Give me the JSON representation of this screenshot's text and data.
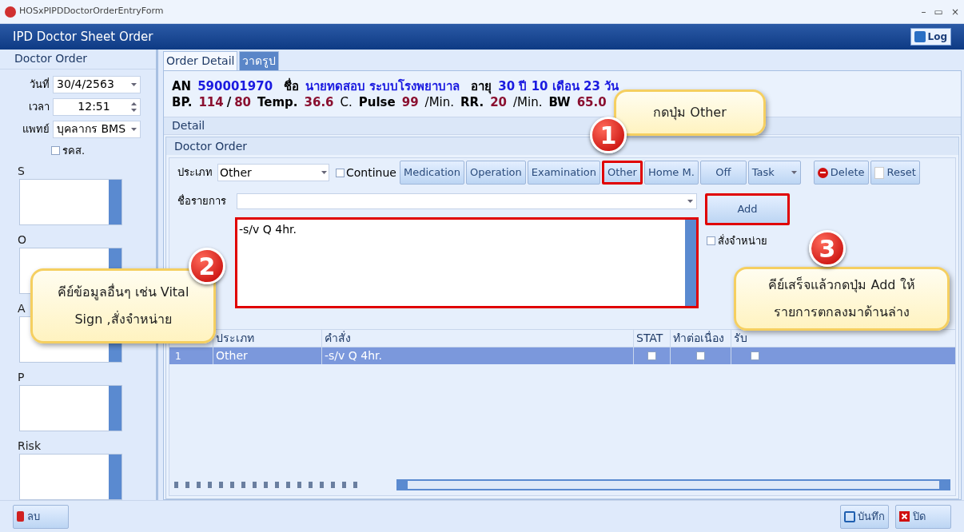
{
  "window": {
    "title": "HOSxPIPDDoctorOrderEntryForm",
    "controls": [
      "–",
      "▭",
      "×"
    ]
  },
  "header": {
    "title": "IPD Doctor Sheet Order",
    "log_button": "Log"
  },
  "left_panel": {
    "title": "Doctor Order",
    "fields": [
      {
        "label": "วันที่",
        "value": "30/4/2563",
        "kind": "dropdown"
      },
      {
        "label": "เวลา",
        "value": "12:51",
        "kind": "spinner"
      },
      {
        "label": "แพทย์",
        "value": "บุคลากร BMS",
        "kind": "dropdown"
      }
    ],
    "checkbox": {
      "label": "รคส.",
      "checked": false
    },
    "notes": [
      {
        "label": "S"
      },
      {
        "label": "O"
      },
      {
        "label": "A"
      },
      {
        "label": "P"
      },
      {
        "label": "Risk"
      }
    ],
    "delete_button": "ลบ"
  },
  "tabs": [
    {
      "label": "Order Detail",
      "selected": true
    },
    {
      "label": "วาดรูป",
      "selected": false
    }
  ],
  "patient": {
    "line1": [
      {
        "label": "AN",
        "value": "590001970"
      },
      {
        "label": "ชื่อ",
        "value": "นายทดสอบ ระบบโรงพยาบาล"
      },
      {
        "label": "อายุ",
        "value": "30 ปี 10 เดือน 23 วัน"
      }
    ],
    "line2": [
      {
        "label": "BP.",
        "value": "114",
        "separator": "/",
        "value2": "80"
      },
      {
        "label": "Temp.",
        "value": "36.6",
        "unit": "C."
      },
      {
        "label": "Pulse",
        "value": "99",
        "unit": "/Min."
      },
      {
        "label": "RR.",
        "value": "20",
        "unit": "/Min."
      },
      {
        "label": "BW",
        "value": "65.0"
      }
    ]
  },
  "detail_title": "Detail",
  "order_group": {
    "title": "Doctor Order",
    "type_label": "ประเภท",
    "type_value": "Other",
    "continue": {
      "label": "Continue",
      "checked": false
    },
    "type_buttons": [
      {
        "label": "Medication",
        "highlighted": false
      },
      {
        "label": "Operation",
        "highlighted": false
      },
      {
        "label": "Examination",
        "highlighted": false
      },
      {
        "label": "Other",
        "highlighted": true
      },
      {
        "label": "Home M.",
        "highlighted": false
      },
      {
        "label": "Off",
        "highlighted": false
      }
    ],
    "task_button": "Task",
    "delete_button": "Delete",
    "reset_button": "Reset",
    "item_label": "ชื่อรายการ",
    "order_text": "-s/v Q 4hr.",
    "order_text_highlighted": true,
    "add_button": {
      "label": "Add",
      "highlighted": true
    },
    "discharge": {
      "label": "สั่งจำหน่าย",
      "checked": false
    }
  },
  "grid": {
    "columns": [
      "ประเภท",
      "คำสั่ง",
      "STAT",
      "ทำต่อเนื่อง",
      "รับ"
    ],
    "rows": [
      {
        "number": "1",
        "type": "Other",
        "order": "-s/v Q 4hr.",
        "stat": false,
        "continue": false,
        "received": false,
        "selected": true
      }
    ]
  },
  "footer": {
    "save_button": "บันทึก",
    "close_button": "ปิด"
  },
  "callouts": [
    {
      "number": "1",
      "text": "กดปุ่ม Other"
    },
    {
      "number": "2",
      "text": "คีย์ข้อมูลอื่นๆ เช่น Vital Sign ,สั่งจำหน่าย"
    },
    {
      "number": "3",
      "text": "คีย์เสร็จแล้วกดปุ่ม Add ให้รายการตกลงมาด้านล่าง"
    }
  ]
}
